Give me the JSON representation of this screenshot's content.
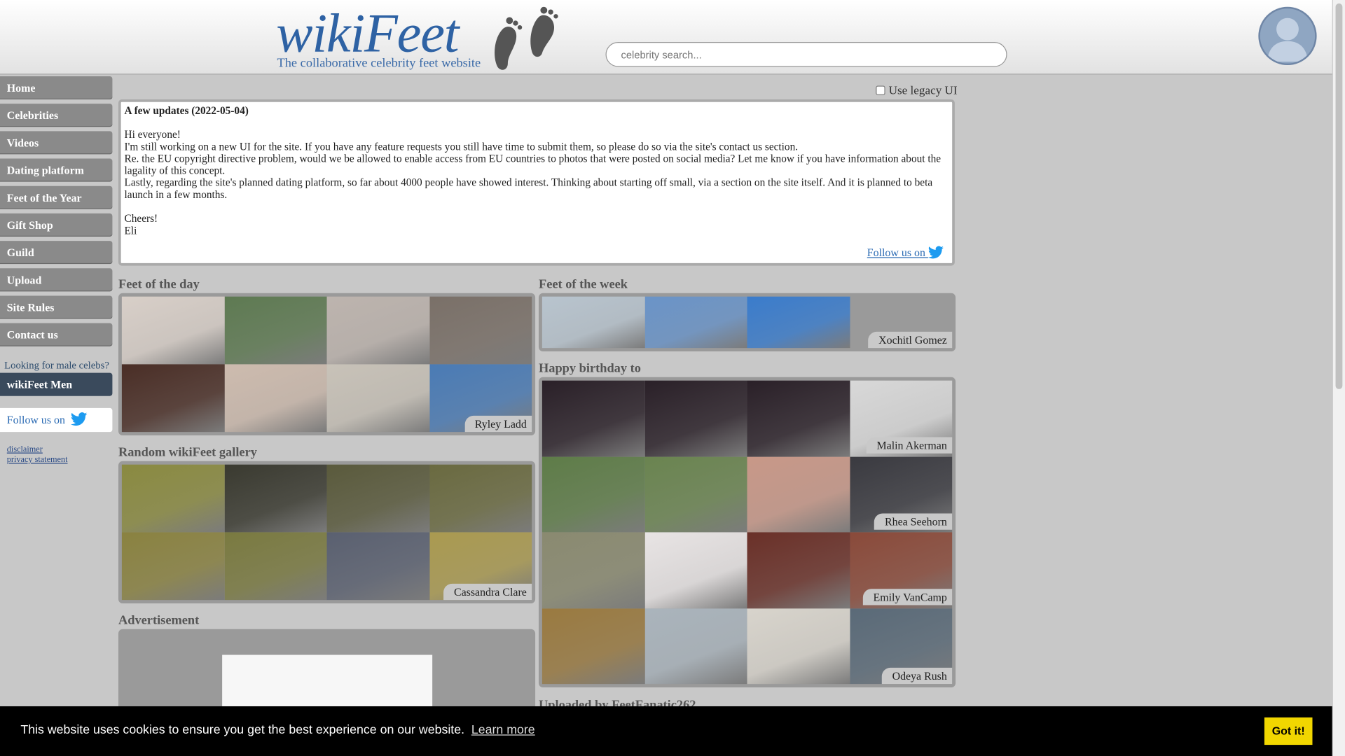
{
  "header": {
    "logo_title": "wikiFeet",
    "logo_subtitle": "The collaborative celebrity feet website",
    "search_placeholder": "celebrity search..."
  },
  "nav": {
    "items": [
      "Home",
      "Celebrities",
      "Videos",
      "Dating platform",
      "Feet of the Year",
      "Gift Shop",
      "Guild",
      "Upload",
      "Site Rules",
      "Contact us"
    ],
    "male_question": "Looking for male celebs?",
    "men_label": "wikiFeet Men",
    "follow_label": "Follow us on",
    "disclaimer": "disclaimer",
    "privacy": "privacy statement"
  },
  "legacy_label": "Use legacy UI",
  "news": {
    "title": "A few updates (2022-05-04)",
    "greeting": "Hi everyone!",
    "line1": "I'm still working on a new UI for the site. If you have any feature requests you still have time to submit them, so please do so via the site's contact us section.",
    "line2": "Re. the EU copyright directive problem, would we be allowed to enable access from EU countries to photos that were posted on social media? Let me know if you have information about the lagality of this concept.",
    "line3": "Lastly, regarding the site's planned dating platform, so far about 4000 people have showed interest. Thinking about starting off small, via a section on the site itself. And it is planned to beta launch in a few months.",
    "signoff": "Cheers!",
    "author": "Eli",
    "follow_label": "Follow us on"
  },
  "sections": {
    "feet_of_day": {
      "title": "Feet of the day",
      "name": "Ryley Ladd",
      "colors": [
        "#d8cfc8",
        "#5e7a52",
        "#bdb4ae",
        "#7a7068",
        "#4a2e26",
        "#cdbbae",
        "#c8c2b8",
        "#4a7bb5"
      ]
    },
    "feet_of_week": {
      "title": "Feet of the week",
      "name": "Xochitl Gomez",
      "colors": [
        "#b8c4ce",
        "#6a94c8",
        "#3a7ccc"
      ]
    },
    "random_gallery": {
      "title": "Random wikiFeet gallery",
      "name": "Cassandra Clare",
      "colors": [
        "#8a8a40",
        "#3a3a30",
        "#5a5a3c",
        "#6a6a40",
        "#8a8240",
        "#7a7a40",
        "#5a6070",
        "#aa9a50"
      ]
    },
    "birthday": {
      "title": "Happy birthday to",
      "names": [
        "Malin Akerman",
        "Rhea Seehorn",
        "Emily VanCamp",
        "Odeya Rush"
      ],
      "colors": [
        "#2a2028",
        "#2a2028",
        "#2a2028",
        "#d8d8d8",
        "#5e7c48",
        "#6a8450",
        "#c89888",
        "#3a3a40",
        "#8a8a70",
        "#e8e4e4",
        "#6a3028",
        "#8a4a3a",
        "#9a7a40",
        "#aab4bc",
        "#d8d4cc",
        "#5a6a78"
      ]
    },
    "advertisement": {
      "title": "Advertisement"
    },
    "uploaded": {
      "title": "Uploaded by FeetFanatic262"
    }
  },
  "cookie": {
    "message": "This website uses cookies to ensure you get the best experience on our website.",
    "learn_more": "Learn more",
    "button": "Got it!"
  }
}
